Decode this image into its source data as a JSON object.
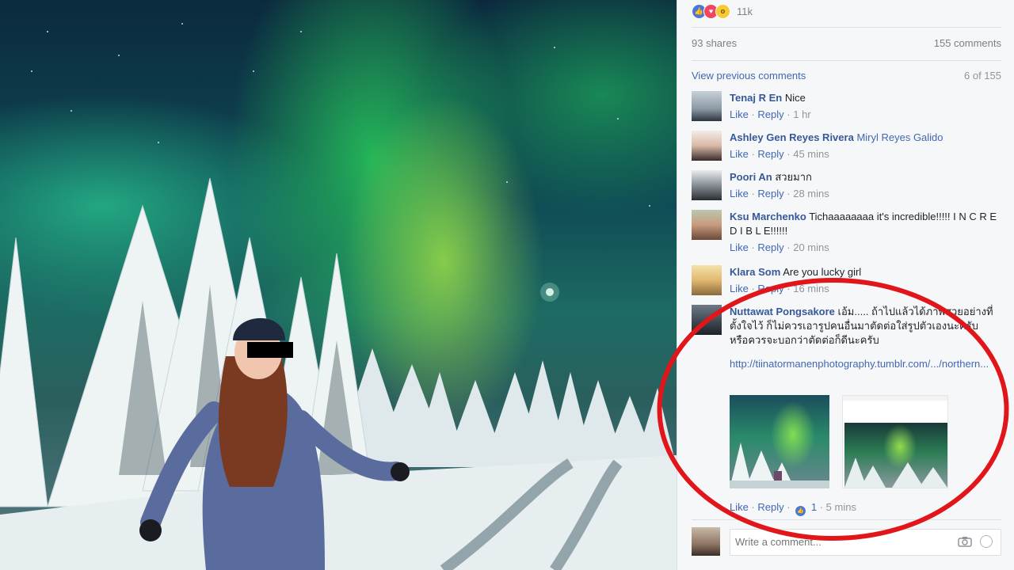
{
  "reactions": {
    "count": "11k",
    "types": [
      "like-icon",
      "love-icon",
      "wow-icon"
    ]
  },
  "stats": {
    "shares": "93 shares",
    "comments": "155 comments"
  },
  "previous": {
    "link": "View previous comments",
    "count": "6 of 155"
  },
  "comments": [
    {
      "name": "Tenaj R En",
      "text": "Nice",
      "like": "Like",
      "reply": "Reply",
      "time": "1 hr"
    },
    {
      "name": "Ashley Gen Reyes Rivera",
      "text": "Miryl Reyes Galido",
      "like": "Like",
      "reply": "Reply",
      "time": "45 mins"
    },
    {
      "name": "Poori An",
      "text": "สวยมาก",
      "like": "Like",
      "reply": "Reply",
      "time": "28 mins"
    },
    {
      "name": "Ksu Marchenko",
      "text": "Tichaaaaaaaa it's incredible!!!!! I N C R E D I B L E!!!!!!",
      "like": "Like",
      "reply": "Reply",
      "time": "20 mins"
    },
    {
      "name": "Klara Som",
      "text": "Are you lucky girl",
      "like": "Like",
      "reply": "Reply",
      "time": "16 mins"
    },
    {
      "name": "Nuttawat Pongsakore",
      "text": "เอ้ม..... ถ้าไปแล้วได้ภาพสวยอย่างที่ตั้งใจไว้ ก็ไม่ควรเอารูปคนอื่นมาตัดต่อใส่รูปตัวเองนะครับ หรือควรจะบอกว่าตัดต่อก็ดีนะครับ",
      "url": "http://tiinatormanenphotography.tumblr.com/.../northern...",
      "like": "Like",
      "reply": "Reply",
      "reactions": "1",
      "time": "5 mins"
    }
  ],
  "compose": {
    "placeholder": "Write a comment..."
  },
  "colors": {
    "link": "#4267b2",
    "name": "#365899",
    "meta": "#90949c",
    "highlight_circle": "#e0161a"
  }
}
